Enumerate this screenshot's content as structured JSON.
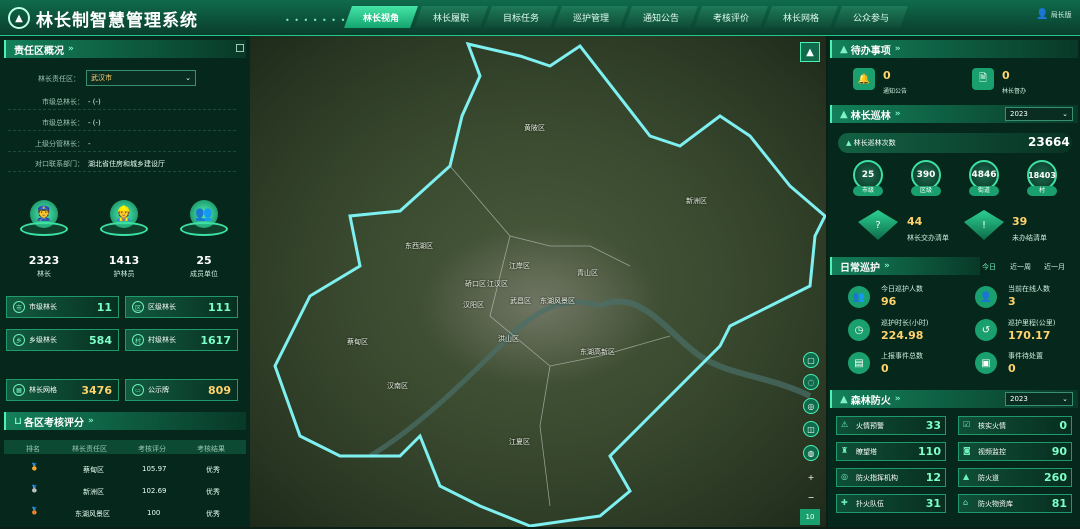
{
  "app": {
    "title": "林长制智慧管理系统",
    "user": "局长版"
  },
  "nav": [
    "林长视角",
    "林长履职",
    "目标任务",
    "巡护管理",
    "通知公告",
    "考核评价",
    "林长网格",
    "公众参与"
  ],
  "left": {
    "responsibility": {
      "title": "责任区概况",
      "area_label": "林长责任区：",
      "area_value": "武汉市",
      "rows": [
        {
          "k": "市级总林长：",
          "v": "- (-)"
        },
        {
          "k": "市级总林长：",
          "v": "- (-)"
        },
        {
          "k": "上级分管林长：",
          "v": "-"
        },
        {
          "k": "对口联系部门：",
          "v": "湖北省住房和城乡建设厅"
        }
      ]
    },
    "summary": [
      {
        "n": "2323",
        "l": "林长"
      },
      {
        "n": "1413",
        "l": "护林员"
      },
      {
        "n": "25",
        "l": "成员单位"
      }
    ],
    "stats": [
      {
        "t": "市级林长",
        "n": "11"
      },
      {
        "t": "区级林长",
        "n": "111"
      },
      {
        "t": "乡级林长",
        "n": "584"
      },
      {
        "t": "村级林长",
        "n": "1617"
      },
      {
        "t": "林长网格",
        "n": "3476"
      },
      {
        "t": "公示牌",
        "n": "809"
      }
    ],
    "ranking": {
      "title": "各区考核评分",
      "headers": [
        "排名",
        "林长责任区",
        "考核评分",
        "考核结果"
      ],
      "rows": [
        {
          "district": "蔡甸区",
          "score": "105.97",
          "result": "优秀"
        },
        {
          "district": "新洲区",
          "score": "102.69",
          "result": "优秀"
        },
        {
          "district": "东湖风景区",
          "score": "100",
          "result": "优秀"
        }
      ]
    }
  },
  "map": {
    "labels": [
      "黄陂区",
      "新洲区",
      "东西湖区",
      "江岸区",
      "青山区",
      "硚口区",
      "江汉区",
      "汉阳区",
      "武昌区",
      "东湖风景区",
      "蔡甸区",
      "洪山区",
      "东湖高新区",
      "汉南区",
      "江夏区"
    ],
    "zoom": "10"
  },
  "right": {
    "todo": {
      "title": "待办事项",
      "items": [
        {
          "n": "0",
          "l": "通知公告"
        },
        {
          "n": "0",
          "l": "林长督办"
        }
      ]
    },
    "patrol": {
      "title": "林长巡林",
      "year": "2023",
      "total_label": "林长巡林次数",
      "total": "23664",
      "levels": [
        {
          "n": "25",
          "l": "市级"
        },
        {
          "n": "390",
          "l": "区级"
        },
        {
          "n": "4846",
          "l": "街道"
        },
        {
          "n": "18403",
          "l": "村"
        }
      ],
      "issues": [
        {
          "n": "44",
          "l": "林长交办清单"
        },
        {
          "n": "39",
          "l": "未办结清单"
        }
      ]
    },
    "daily": {
      "title": "日常巡护",
      "tabs": [
        "今日",
        "近一周",
        "近一月"
      ],
      "items": [
        {
          "l": "今日巡护人数",
          "n": "96"
        },
        {
          "l": "当前在线人数",
          "n": "3"
        },
        {
          "l": "巡护时长(小时)",
          "n": "224.98"
        },
        {
          "l": "巡护里程(公里)",
          "n": "170.17"
        },
        {
          "l": "上报事件总数",
          "n": "0"
        },
        {
          "l": "事件待处置",
          "n": "0"
        }
      ]
    },
    "fire": {
      "title": "森林防火",
      "year": "2023",
      "items": [
        {
          "t": "火情预警",
          "n": "33"
        },
        {
          "t": "核实火情",
          "n": "0"
        },
        {
          "t": "瞭望塔",
          "n": "110"
        },
        {
          "t": "视频监控",
          "n": "90"
        },
        {
          "t": "防火指挥机构",
          "n": "12"
        },
        {
          "t": "防火道",
          "n": "260"
        },
        {
          "t": "扑火队伍",
          "n": "31"
        },
        {
          "t": "防火物资库",
          "n": "81"
        }
      ]
    }
  }
}
